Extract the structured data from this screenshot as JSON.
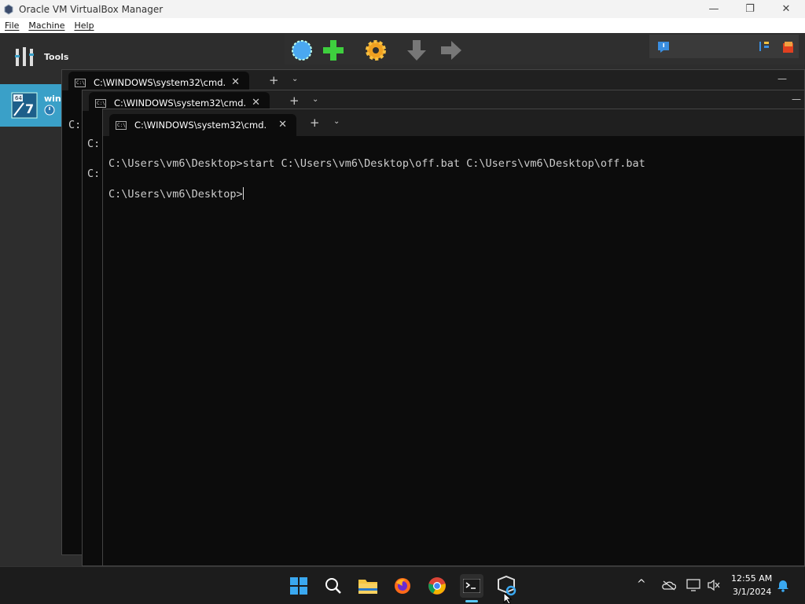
{
  "vbox": {
    "title": "Oracle VM VirtualBox Manager",
    "menu": [
      "File",
      "Machine",
      "Help"
    ],
    "tools_label": "Tools",
    "vm_name_partial": "wind",
    "vm_badge": "64",
    "vm_version": "7",
    "window_controls": [
      "—",
      "❐",
      "✕"
    ]
  },
  "terminals": [
    {
      "tab_title": "C:\\WINDOWS\\system32\\cmd.",
      "lines": [
        "C:"
      ]
    },
    {
      "tab_title": "C:\\WINDOWS\\system32\\cmd.",
      "lines": [
        "C:",
        "C:"
      ]
    },
    {
      "tab_title": "C:\\WINDOWS\\system32\\cmd.",
      "lines": [
        "C:\\Users\\vm6\\Desktop>start C:\\Users\\vm6\\Desktop\\off.bat C:\\Users\\vm6\\Desktop\\off.bat",
        "C:\\Users\\vm6\\Desktop>"
      ]
    }
  ],
  "tab_controls": {
    "close": "✕",
    "new_tab": "+",
    "dropdown": "⌄",
    "minimize": "—"
  },
  "taskbar": {
    "clock_time": "12:55 AM",
    "clock_date": "3/1/2024"
  },
  "colors": {
    "terminal_bg": "#0c0c0c",
    "terminal_text": "#cccccc",
    "vbox_selected": "#3aa0c8",
    "taskbar_bg": "#1c1c1c"
  }
}
